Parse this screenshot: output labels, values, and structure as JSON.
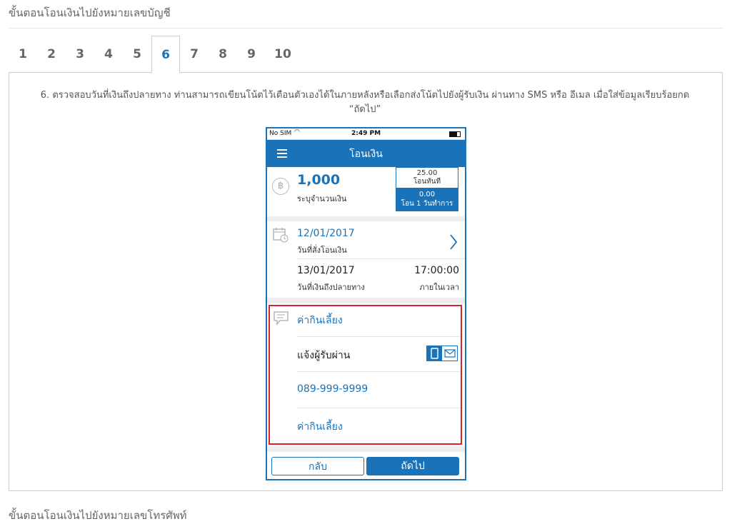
{
  "section_title": "ขั้นตอนโอนเงินไปยังหมายเลขบัญชี",
  "tabs": [
    "1",
    "2",
    "3",
    "4",
    "5",
    "6",
    "7",
    "8",
    "9",
    "10"
  ],
  "active_tab": "6",
  "instruction_line1": "6. ตรวจสอบวันที่เงินถึงปลายทาง ท่านสามารถเขียนโน้ตไว้เตือนตัวเองได้ในภายหลังหรือเลือกส่งโน้ตไปยังผู้รับเงิน ผ่านทาง SMS หรือ อีเมล เมื่อใส่ข้อมูลเรียบร้อยกด",
  "instruction_line2": "“ถัดไป”",
  "phone": {
    "status": {
      "carrier": "No SIM",
      "time": "2:49 PM"
    },
    "title": "โอนเงิน",
    "amount": "1,000",
    "amount_label": "ระบุจำนวนเงิน",
    "fee_instant_value": "25.00",
    "fee_instant_label": "โอนทันที",
    "fee_next_value": "0.00",
    "fee_next_label": "โอน 1 วันทำการ",
    "order_date": "12/01/2017",
    "order_date_label": "วันที่สั่งโอนเงิน",
    "arrive_date": "13/01/2017",
    "arrive_date_label": "วันที่เงินถึงปลายทาง",
    "arrive_time": "17:00:00",
    "arrive_time_label": "ภายในเวลา",
    "note": "ค่ากินเลี้ยง",
    "notify_label": "แจ้งผู้รับผ่าน",
    "phone_number": "089-999-9999",
    "sms_note": "ค่ากินเลี้ยง",
    "back_button": "กลับ",
    "next_button": "ถัดไป"
  },
  "next_section_title": "ขั้นตอนโอนเงินไปยังหมายเลขโทรศัพท์",
  "colors": {
    "accent": "#1a73b8",
    "highlight": "#d9242f"
  }
}
